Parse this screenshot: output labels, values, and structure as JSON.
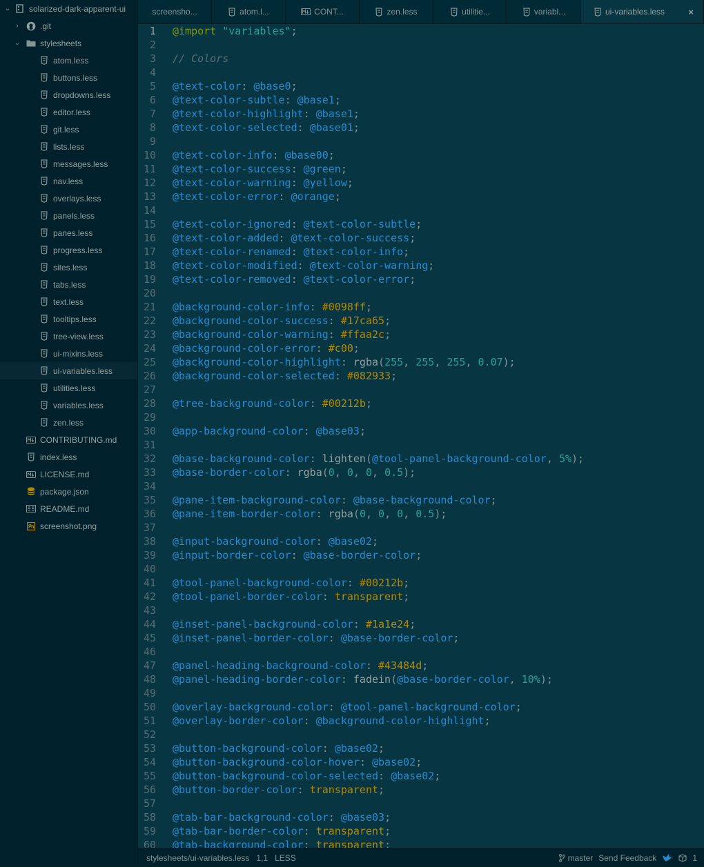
{
  "tree": {
    "root": "solarized-dark-apparent-ui",
    "items": [
      {
        "label": ".git",
        "kind": "folder-git",
        "depth": 1,
        "chevron": "right"
      },
      {
        "label": "stylesheets",
        "kind": "folder",
        "depth": 1,
        "chevron": "down"
      },
      {
        "label": "atom.less",
        "kind": "file-less",
        "depth": 2
      },
      {
        "label": "buttons.less",
        "kind": "file-less",
        "depth": 2
      },
      {
        "label": "dropdowns.less",
        "kind": "file-less",
        "depth": 2
      },
      {
        "label": "editor.less",
        "kind": "file-less",
        "depth": 2
      },
      {
        "label": "git.less",
        "kind": "file-less",
        "depth": 2
      },
      {
        "label": "lists.less",
        "kind": "file-less",
        "depth": 2
      },
      {
        "label": "messages.less",
        "kind": "file-less",
        "depth": 2
      },
      {
        "label": "nav.less",
        "kind": "file-less",
        "depth": 2
      },
      {
        "label": "overlays.less",
        "kind": "file-less",
        "depth": 2
      },
      {
        "label": "panels.less",
        "kind": "file-less",
        "depth": 2
      },
      {
        "label": "panes.less",
        "kind": "file-less",
        "depth": 2
      },
      {
        "label": "progress.less",
        "kind": "file-less",
        "depth": 2
      },
      {
        "label": "sites.less",
        "kind": "file-less",
        "depth": 2
      },
      {
        "label": "tabs.less",
        "kind": "file-less",
        "depth": 2
      },
      {
        "label": "text.less",
        "kind": "file-less",
        "depth": 2
      },
      {
        "label": "tooltips.less",
        "kind": "file-less",
        "depth": 2
      },
      {
        "label": "tree-view.less",
        "kind": "file-less",
        "depth": 2
      },
      {
        "label": "ui-mixins.less",
        "kind": "file-less",
        "depth": 2
      },
      {
        "label": "ui-variables.less",
        "kind": "file-less",
        "depth": 2,
        "selected": true
      },
      {
        "label": "utilities.less",
        "kind": "file-less",
        "depth": 2
      },
      {
        "label": "variables.less",
        "kind": "file-less",
        "depth": 2
      },
      {
        "label": "zen.less",
        "kind": "file-less",
        "depth": 2
      },
      {
        "label": "CONTRIBUTING.md",
        "kind": "file-md",
        "depth": 1
      },
      {
        "label": "index.less",
        "kind": "file-less",
        "depth": 1
      },
      {
        "label": "LICENSE.md",
        "kind": "file-md",
        "depth": 1
      },
      {
        "label": "package.json",
        "kind": "file-json",
        "depth": 1
      },
      {
        "label": "README.md",
        "kind": "file-readme",
        "depth": 1
      },
      {
        "label": "screenshot.png",
        "kind": "file-image",
        "depth": 1
      }
    ]
  },
  "tabs": [
    {
      "label": "screensho...",
      "icon": "none"
    },
    {
      "label": "atom.l...",
      "icon": "less"
    },
    {
      "label": "CONT...",
      "icon": "md"
    },
    {
      "label": "zen.less",
      "icon": "less"
    },
    {
      "label": "utilitie...",
      "icon": "less"
    },
    {
      "label": "variabl...",
      "icon": "less"
    },
    {
      "label": "ui-variables.less",
      "icon": "less",
      "active": true,
      "close": "×"
    }
  ],
  "code": [
    [
      [
        "@import ",
        "kw"
      ],
      [
        "\"variables\"",
        "str"
      ],
      [
        ";",
        "plain"
      ]
    ],
    [],
    [
      [
        "// Colors",
        "com"
      ]
    ],
    [],
    [
      [
        "@text-color",
        "var"
      ],
      [
        ": ",
        "plain"
      ],
      [
        "@base0",
        "var"
      ],
      [
        ";",
        "plain"
      ]
    ],
    [
      [
        "@text-color-subtle",
        "var"
      ],
      [
        ": ",
        "plain"
      ],
      [
        "@base1",
        "var"
      ],
      [
        ";",
        "plain"
      ]
    ],
    [
      [
        "@text-color-highlight",
        "var"
      ],
      [
        ": ",
        "plain"
      ],
      [
        "@base1",
        "var"
      ],
      [
        ";",
        "plain"
      ]
    ],
    [
      [
        "@text-color-selected",
        "var"
      ],
      [
        ": ",
        "plain"
      ],
      [
        "@base01",
        "var"
      ],
      [
        ";",
        "plain"
      ]
    ],
    [],
    [
      [
        "@text-color-info",
        "var"
      ],
      [
        ": ",
        "plain"
      ],
      [
        "@base00",
        "var"
      ],
      [
        ";",
        "plain"
      ]
    ],
    [
      [
        "@text-color-success",
        "var"
      ],
      [
        ": ",
        "plain"
      ],
      [
        "@green",
        "var"
      ],
      [
        ";",
        "plain"
      ]
    ],
    [
      [
        "@text-color-warning",
        "var"
      ],
      [
        ": ",
        "plain"
      ],
      [
        "@yellow",
        "var"
      ],
      [
        ";",
        "plain"
      ]
    ],
    [
      [
        "@text-color-error",
        "var"
      ],
      [
        ": ",
        "plain"
      ],
      [
        "@orange",
        "var"
      ],
      [
        ";",
        "plain"
      ]
    ],
    [],
    [
      [
        "@text-color-ignored",
        "var"
      ],
      [
        ": ",
        "plain"
      ],
      [
        "@text-color-subtle",
        "var"
      ],
      [
        ";",
        "plain"
      ]
    ],
    [
      [
        "@text-color-added",
        "var"
      ],
      [
        ": ",
        "plain"
      ],
      [
        "@text-color-success",
        "var"
      ],
      [
        ";",
        "plain"
      ]
    ],
    [
      [
        "@text-color-renamed",
        "var"
      ],
      [
        ": ",
        "plain"
      ],
      [
        "@text-color-info",
        "var"
      ],
      [
        ";",
        "plain"
      ]
    ],
    [
      [
        "@text-color-modified",
        "var"
      ],
      [
        ": ",
        "plain"
      ],
      [
        "@text-color-warning",
        "var"
      ],
      [
        ";",
        "plain"
      ]
    ],
    [
      [
        "@text-color-removed",
        "var"
      ],
      [
        ": ",
        "plain"
      ],
      [
        "@text-color-error",
        "var"
      ],
      [
        ";",
        "plain"
      ]
    ],
    [],
    [
      [
        "@background-color-info",
        "var"
      ],
      [
        ": ",
        "plain"
      ],
      [
        "#0098ff",
        "num"
      ],
      [
        ";",
        "plain"
      ]
    ],
    [
      [
        "@background-color-success",
        "var"
      ],
      [
        ": ",
        "plain"
      ],
      [
        "#17ca65",
        "num"
      ],
      [
        ";",
        "plain"
      ]
    ],
    [
      [
        "@background-color-warning",
        "var"
      ],
      [
        ": ",
        "plain"
      ],
      [
        "#ffaa2c",
        "num"
      ],
      [
        ";",
        "plain"
      ]
    ],
    [
      [
        "@background-color-error",
        "var"
      ],
      [
        ": ",
        "plain"
      ],
      [
        "#c00",
        "num"
      ],
      [
        ";",
        "plain"
      ]
    ],
    [
      [
        "@background-color-highlight",
        "var"
      ],
      [
        ": ",
        "plain"
      ],
      [
        "rgba",
        "fn"
      ],
      [
        "(",
        "plain"
      ],
      [
        "255",
        "str"
      ],
      [
        ", ",
        "plain"
      ],
      [
        "255",
        "str"
      ],
      [
        ", ",
        "plain"
      ],
      [
        "255",
        "str"
      ],
      [
        ", ",
        "plain"
      ],
      [
        "0.07",
        "str"
      ],
      [
        ");",
        "plain"
      ]
    ],
    [
      [
        "@background-color-selected",
        "var"
      ],
      [
        ": ",
        "plain"
      ],
      [
        "#082933",
        "num"
      ],
      [
        ";",
        "plain"
      ]
    ],
    [],
    [
      [
        "@tree-background-color",
        "var"
      ],
      [
        ": ",
        "plain"
      ],
      [
        "#00212b",
        "num"
      ],
      [
        ";",
        "plain"
      ]
    ],
    [],
    [
      [
        "@app-background-color",
        "var"
      ],
      [
        ": ",
        "plain"
      ],
      [
        "@base03",
        "var"
      ],
      [
        ";",
        "plain"
      ]
    ],
    [],
    [
      [
        "@base-background-color",
        "var"
      ],
      [
        ": ",
        "plain"
      ],
      [
        "lighten",
        "fn"
      ],
      [
        "(",
        "plain"
      ],
      [
        "@tool-panel-background-color",
        "var"
      ],
      [
        ", ",
        "plain"
      ],
      [
        "5%",
        "str"
      ],
      [
        ");",
        "plain"
      ]
    ],
    [
      [
        "@base-border-color",
        "var"
      ],
      [
        ": ",
        "plain"
      ],
      [
        "rgba",
        "fn"
      ],
      [
        "(",
        "plain"
      ],
      [
        "0",
        "str"
      ],
      [
        ", ",
        "plain"
      ],
      [
        "0",
        "str"
      ],
      [
        ", ",
        "plain"
      ],
      [
        "0",
        "str"
      ],
      [
        ", ",
        "plain"
      ],
      [
        "0.5",
        "str"
      ],
      [
        ");",
        "plain"
      ]
    ],
    [],
    [
      [
        "@pane-item-background-color",
        "var"
      ],
      [
        ": ",
        "plain"
      ],
      [
        "@base-background-color",
        "var"
      ],
      [
        ";",
        "plain"
      ]
    ],
    [
      [
        "@pane-item-border-color",
        "var"
      ],
      [
        ": ",
        "plain"
      ],
      [
        "rgba",
        "fn"
      ],
      [
        "(",
        "plain"
      ],
      [
        "0",
        "str"
      ],
      [
        ", ",
        "plain"
      ],
      [
        "0",
        "str"
      ],
      [
        ", ",
        "plain"
      ],
      [
        "0",
        "str"
      ],
      [
        ", ",
        "plain"
      ],
      [
        "0.5",
        "str"
      ],
      [
        ");",
        "plain"
      ]
    ],
    [],
    [
      [
        "@input-background-color",
        "var"
      ],
      [
        ": ",
        "plain"
      ],
      [
        "@base02",
        "var"
      ],
      [
        ";",
        "plain"
      ]
    ],
    [
      [
        "@input-border-color",
        "var"
      ],
      [
        ": ",
        "plain"
      ],
      [
        "@base-border-color",
        "var"
      ],
      [
        ";",
        "plain"
      ]
    ],
    [],
    [
      [
        "@tool-panel-background-color",
        "var"
      ],
      [
        ": ",
        "plain"
      ],
      [
        "#00212b",
        "num"
      ],
      [
        ";",
        "plain"
      ]
    ],
    [
      [
        "@tool-panel-border-color",
        "var"
      ],
      [
        ": ",
        "plain"
      ],
      [
        "transparent",
        "num"
      ],
      [
        ";",
        "plain"
      ]
    ],
    [],
    [
      [
        "@inset-panel-background-color",
        "var"
      ],
      [
        ": ",
        "plain"
      ],
      [
        "#1a1e24",
        "num"
      ],
      [
        ";",
        "plain"
      ]
    ],
    [
      [
        "@inset-panel-border-color",
        "var"
      ],
      [
        ": ",
        "plain"
      ],
      [
        "@base-border-color",
        "var"
      ],
      [
        ";",
        "plain"
      ]
    ],
    [],
    [
      [
        "@panel-heading-background-color",
        "var"
      ],
      [
        ": ",
        "plain"
      ],
      [
        "#43484d",
        "num"
      ],
      [
        ";",
        "plain"
      ]
    ],
    [
      [
        "@panel-heading-border-color",
        "var"
      ],
      [
        ": ",
        "plain"
      ],
      [
        "fadein",
        "fn"
      ],
      [
        "(",
        "plain"
      ],
      [
        "@base-border-color",
        "var"
      ],
      [
        ", ",
        "plain"
      ],
      [
        "10%",
        "str"
      ],
      [
        ");",
        "plain"
      ]
    ],
    [],
    [
      [
        "@overlay-background-color",
        "var"
      ],
      [
        ": ",
        "plain"
      ],
      [
        "@tool-panel-background-color",
        "var"
      ],
      [
        ";",
        "plain"
      ]
    ],
    [
      [
        "@overlay-border-color",
        "var"
      ],
      [
        ": ",
        "plain"
      ],
      [
        "@background-color-highlight",
        "var"
      ],
      [
        ";",
        "plain"
      ]
    ],
    [],
    [
      [
        "@button-background-color",
        "var"
      ],
      [
        ": ",
        "plain"
      ],
      [
        "@base02",
        "var"
      ],
      [
        ";",
        "plain"
      ]
    ],
    [
      [
        "@button-background-color-hover",
        "var"
      ],
      [
        ": ",
        "plain"
      ],
      [
        "@base02",
        "var"
      ],
      [
        ";",
        "plain"
      ]
    ],
    [
      [
        "@button-background-color-selected",
        "var"
      ],
      [
        ": ",
        "plain"
      ],
      [
        "@base02",
        "var"
      ],
      [
        ";",
        "plain"
      ]
    ],
    [
      [
        "@button-border-color",
        "var"
      ],
      [
        ": ",
        "plain"
      ],
      [
        "transparent",
        "num"
      ],
      [
        ";",
        "plain"
      ]
    ],
    [],
    [
      [
        "@tab-bar-background-color",
        "var"
      ],
      [
        ": ",
        "plain"
      ],
      [
        "@base03",
        "var"
      ],
      [
        ";",
        "plain"
      ]
    ],
    [
      [
        "@tab-bar-border-color",
        "var"
      ],
      [
        ": ",
        "plain"
      ],
      [
        "transparent",
        "num"
      ],
      [
        ";",
        "plain"
      ]
    ],
    [
      [
        "@tab-background-color",
        "var"
      ],
      [
        ": ",
        "plain"
      ],
      [
        "transparent",
        "num"
      ],
      [
        ";",
        "plain"
      ]
    ]
  ],
  "current_line": 1,
  "status": {
    "path": "stylesheets/ui-variables.less",
    "cursor": "1,1",
    "grammar": "LESS",
    "branch": "master",
    "feedback": "Send Feedback",
    "count": "1"
  },
  "colors": {
    "tree_bg": "#00212b",
    "editor_bg": "#073642",
    "selected_bg": "#082933",
    "accent": "#268bd2"
  }
}
